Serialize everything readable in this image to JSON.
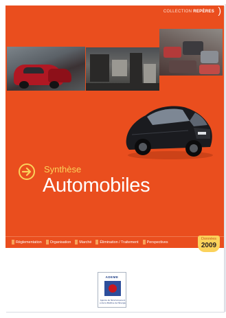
{
  "collection": {
    "prefix": "COLLECTION",
    "name": "REPÈRES"
  },
  "title": {
    "small": "Synthèse",
    "large": "Automobiles"
  },
  "nav": [
    {
      "label": "Réglementation"
    },
    {
      "label": "Organisation"
    },
    {
      "label": "Marché"
    },
    {
      "label": "Élimination / Traitement"
    },
    {
      "label": "Perspectives"
    }
  ],
  "badge": {
    "label": "Données",
    "year": "2009"
  },
  "logo": {
    "name": "ADEME",
    "subtitle": "Agence de l'Environnement et de la Maîtrise de l'Énergie"
  },
  "colors": {
    "background": "#ea4e1e",
    "accent": "#fbd25b",
    "logo_blue": "#2d4e9c",
    "logo_red": "#c8161d"
  },
  "icons": [
    "arrow-right-circle-icon"
  ]
}
